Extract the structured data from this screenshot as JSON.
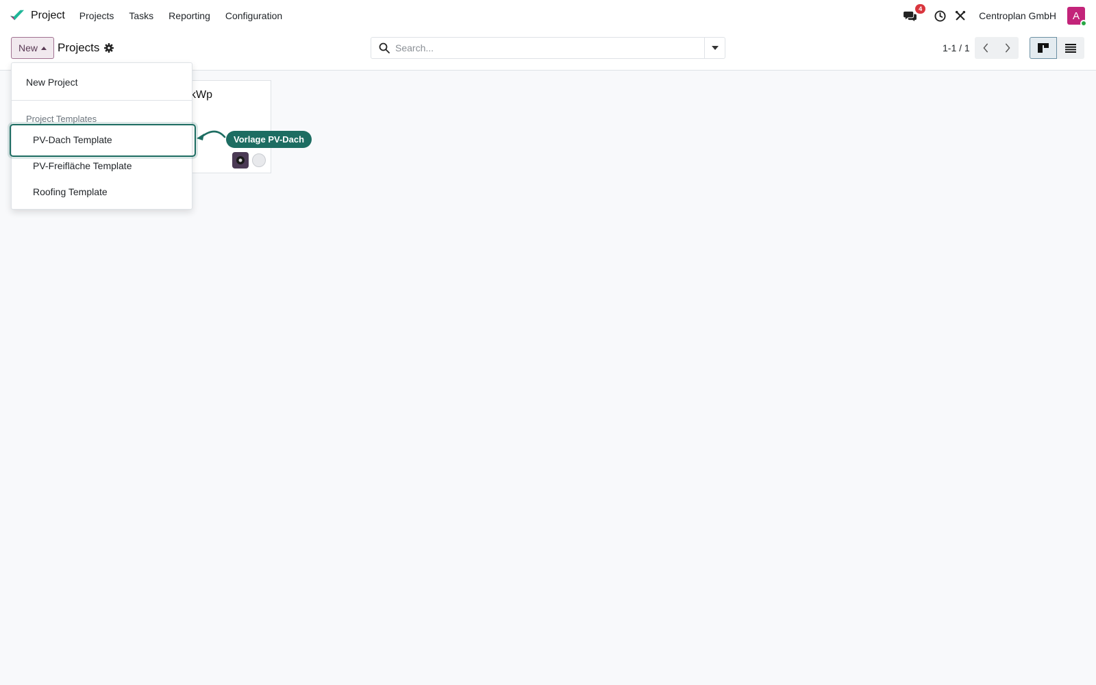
{
  "navbar": {
    "app_name": "Project",
    "menu": [
      {
        "label": "Projects"
      },
      {
        "label": "Tasks"
      },
      {
        "label": "Reporting"
      },
      {
        "label": "Configuration"
      }
    ],
    "messages_badge": "4",
    "company": "Centroplan GmbH",
    "user_initial": "A",
    "brand_colors": [
      "#21b799",
      "#1d6d62",
      "#c3247a"
    ]
  },
  "control_panel": {
    "new_label": "New",
    "breadcrumb": "Projects",
    "search": {
      "placeholder": "Search..."
    },
    "pager": "1-1 / 1",
    "icons": [
      "gear-icon",
      "search-icon",
      "chevron-left-icon",
      "chevron-right-icon",
      "kanban-view-icon",
      "list-view-icon"
    ]
  },
  "kanban": {
    "card_title_visible": "kWp"
  },
  "dropdown": {
    "new_project": "New Project",
    "templates_header": "Project Templates",
    "templates": [
      {
        "label": "PV-Dach Template"
      },
      {
        "label": "PV-Freifläche Template"
      },
      {
        "label": "Roofing Template"
      }
    ]
  },
  "tooltip": {
    "text": "Vorlage PV-Dach",
    "color": "#1d6d62"
  }
}
